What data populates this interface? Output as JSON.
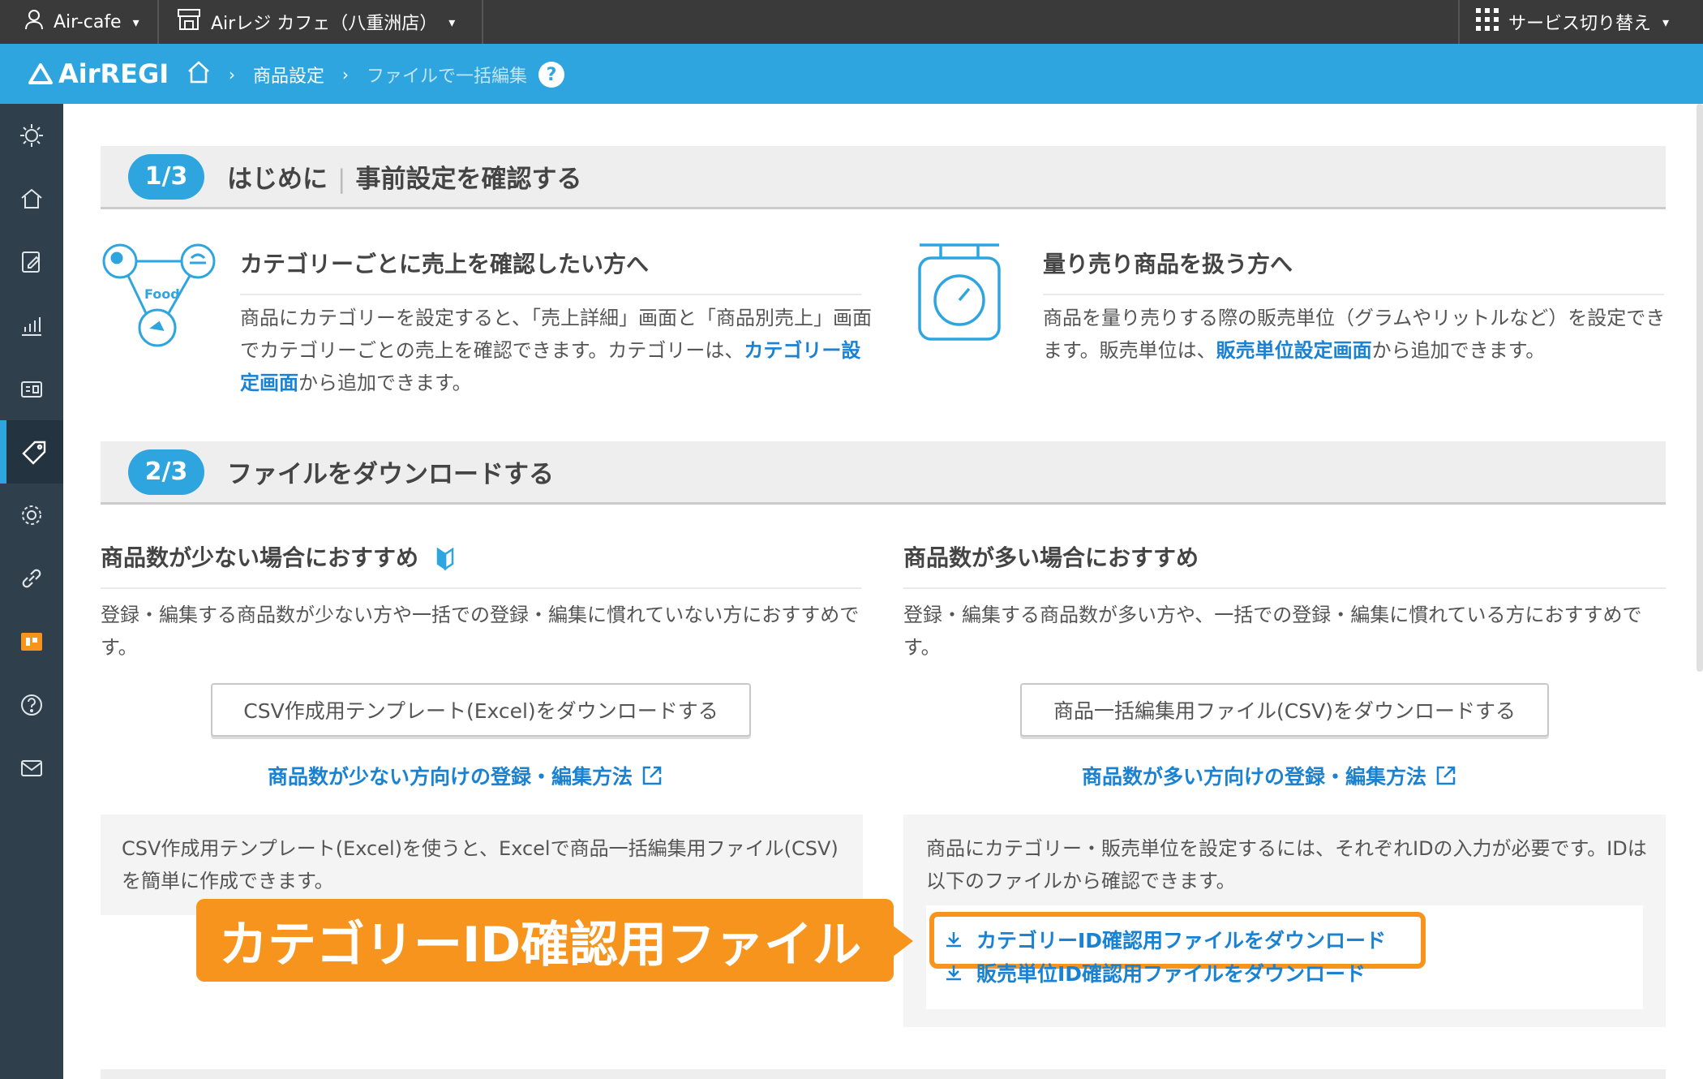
{
  "topbar": {
    "account": "Air-cafe",
    "store": "Airレジ カフェ（八重洲店）",
    "service_switch": "サービス切り替え"
  },
  "header": {
    "logo": "AirREGI",
    "breadcrumb": [
      "商品設定",
      "ファイルで一括編集"
    ],
    "help": "?"
  },
  "sidebar": {
    "items": [
      "sun-icon",
      "home-icon",
      "edit-icon",
      "chart-icon",
      "register-icon",
      "tag-icon",
      "gear-icon",
      "link-icon",
      "app-icon",
      "help-icon",
      "mail-icon"
    ],
    "active_index": 5
  },
  "section1": {
    "step": "1/3",
    "title_main": "はじめに",
    "title_sub": "事前設定を確認する",
    "category": {
      "title": "カテゴリーごとに売上を確認したい方へ",
      "icon_label": "Food",
      "text_before": "商品にカテゴリーを設定すると、「売上詳細」画面と「商品別売上」画面でカテゴリーごとの売上を確認できます。カテゴリーは、",
      "link": "カテゴリー設定画面",
      "text_after": "から追加できます。"
    },
    "weight": {
      "title": "量り売り商品を扱う方へ",
      "text_before": "商品を量り売りする際の販売単位（グラムやリットルなど）を設定できます。販売単位は、",
      "link": "販売単位設定画面",
      "text_after": "から追加できます。"
    }
  },
  "section2": {
    "step": "2/3",
    "title": "ファイルをダウンロードする",
    "few": {
      "title": "商品数が少ない場合におすすめ",
      "desc": "登録・編集する商品数が少ない方や一括での登録・編集に慣れていない方におすすめです。",
      "button": "CSV作成用テンプレート(Excel)をダウンロードする",
      "howto": "商品数が少ない方向けの登録・編集方法",
      "note": "CSV作成用テンプレート(Excel)を使うと、Excelで商品一括編集用ファイル(CSV)を簡単に作成できます。"
    },
    "many": {
      "title": "商品数が多い場合におすすめ",
      "desc": "登録・編集する商品数が多い方や、一括での登録・編集に慣れている方におすすめです。",
      "button": "商品一括編集用ファイル(CSV)をダウンロードする",
      "howto": "商品数が多い方向けの登録・編集方法",
      "note": "商品にカテゴリー・販売単位を設定するには、それぞれIDの入力が必要です。IDは以下のファイルから確認できます。",
      "category_file": "カテゴリーID確認用ファイルをダウンロード",
      "unit_file": "販売単位ID確認用ファイルをダウンロード"
    }
  },
  "callout": {
    "text": "カテゴリーID確認用ファイル",
    "color": "#f7941d"
  },
  "colors": {
    "accent": "#2fa5e0",
    "sidebar": "#2f3f4b",
    "link": "#1a82d2"
  }
}
